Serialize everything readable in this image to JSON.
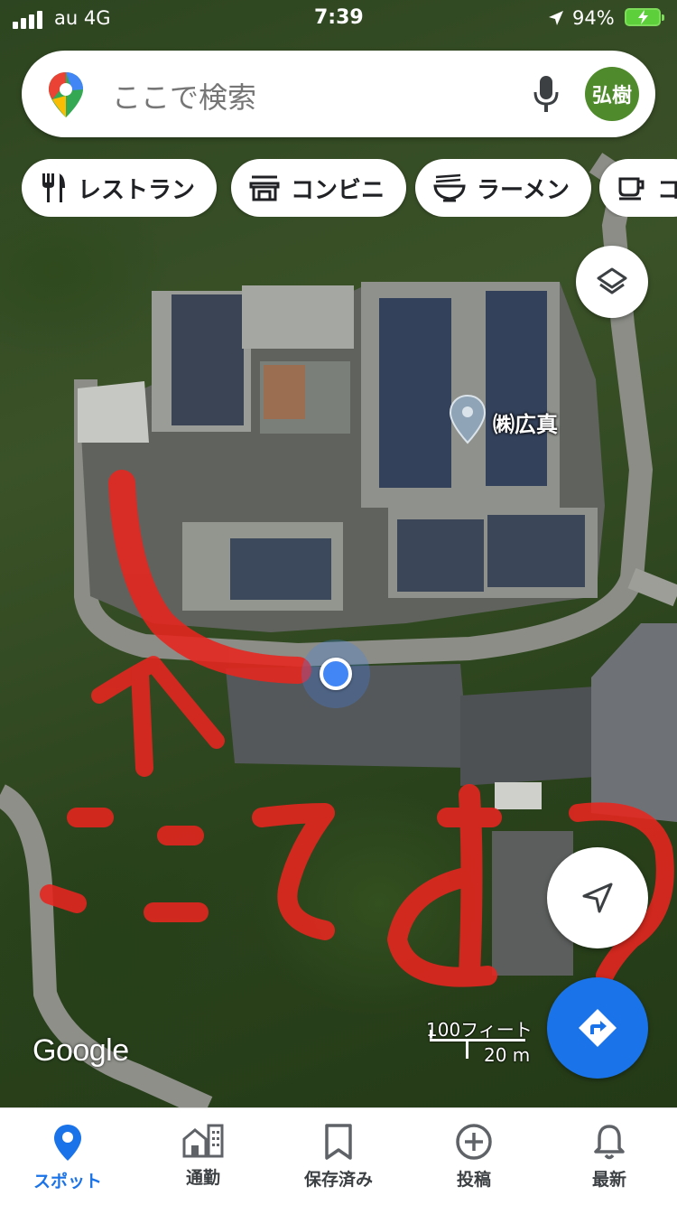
{
  "status_bar": {
    "carrier": "au  4G",
    "time": "7:39",
    "battery": "94%"
  },
  "search": {
    "placeholder": "ここで検索",
    "avatar_text": "弘樹"
  },
  "chips": [
    {
      "label": "レストラン",
      "icon": "fork-knife-icon"
    },
    {
      "label": "コンビニ",
      "icon": "store-icon"
    },
    {
      "label": "ラーメン",
      "icon": "ramen-icon"
    },
    {
      "label": "コ",
      "icon": "coffee-icon"
    }
  ],
  "map": {
    "place_label": "㈱広真",
    "logo": "Google",
    "scale_ft": "100フィート",
    "scale_m": "20 m",
    "annotation_color": "#e8251f"
  },
  "bottom_nav": [
    {
      "label": "スポット",
      "icon": "pin-icon",
      "active": true
    },
    {
      "label": "通勤",
      "icon": "commute-icon",
      "active": false
    },
    {
      "label": "保存済み",
      "icon": "bookmark-icon",
      "active": false
    },
    {
      "label": "投稿",
      "icon": "plus-circle-icon",
      "active": false
    },
    {
      "label": "最新",
      "icon": "bell-icon",
      "active": false
    }
  ],
  "colors": {
    "accent": "#1a73e8",
    "avatar_bg": "#4f8a2c"
  }
}
